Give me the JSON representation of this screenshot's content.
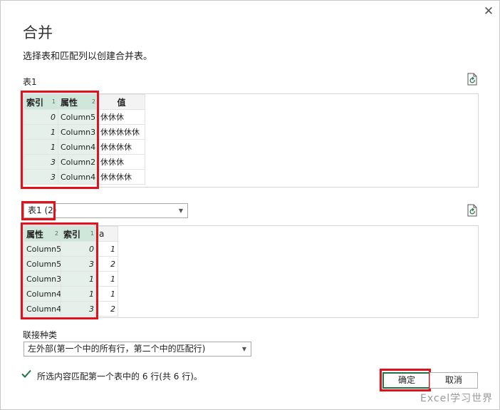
{
  "dialog": {
    "close_symbol": "✕",
    "title": "合并",
    "subtitle": "选择表和匹配列以创建合并表。"
  },
  "table1": {
    "label": "表1",
    "refresh_icon": "refresh-file-icon",
    "columns": [
      {
        "name": "索引",
        "order": "1",
        "selected": true
      },
      {
        "name": "属性",
        "order": "2",
        "selected": true
      },
      {
        "name": "值",
        "order": "",
        "selected": false
      }
    ],
    "rows": [
      [
        "0",
        "Column5",
        "休休休"
      ],
      [
        "1",
        "Column3",
        "休休休休休"
      ],
      [
        "1",
        "Column4",
        "休休休休"
      ],
      [
        "3",
        "Column2",
        "休休休"
      ],
      [
        "3",
        "Column4",
        "休休休休"
      ]
    ]
  },
  "table2": {
    "selector_value": "表1 (2)",
    "refresh_icon": "refresh-file-icon",
    "columns": [
      {
        "name": "属性",
        "order": "2",
        "selected": true
      },
      {
        "name": "索引",
        "order": "1",
        "selected": true
      },
      {
        "name": "a",
        "order": "",
        "selected": false
      }
    ],
    "rows": [
      [
        "Column5",
        "0",
        "1"
      ],
      [
        "Column5",
        "3",
        "2"
      ],
      [
        "Column3",
        "1",
        "1"
      ],
      [
        "Column4",
        "1",
        "1"
      ],
      [
        "Column4",
        "3",
        "2"
      ]
    ]
  },
  "join": {
    "label": "联接种类",
    "selected": "左外部(第一个中的所有行，第二个中的匹配行)"
  },
  "status": {
    "icon": "checkmark-icon",
    "text": "所选内容匹配第一个表中的 6 行(共 6 行)。"
  },
  "buttons": {
    "ok": "确定",
    "cancel": "取消"
  },
  "watermark": "Excel学习世界",
  "colors": {
    "highlight_red": "#e0121b",
    "selected_header": "#cfe6da",
    "selected_cell": "#e4f0e9",
    "accent_green": "#217346"
  }
}
